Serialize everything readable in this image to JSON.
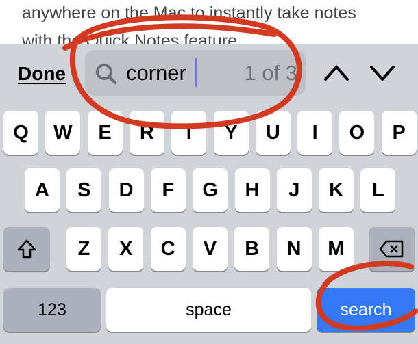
{
  "document": {
    "lines": [
      "anywhere on the Mac to instantly take notes",
      "with the Quick Notes feature"
    ]
  },
  "find_bar": {
    "done_label": "Done",
    "search_value": "corner",
    "match_count": "1 of 3",
    "search_icon": "magnifier-icon",
    "prev_icon": "chevron-up-icon",
    "next_icon": "chevron-down-icon"
  },
  "keyboard": {
    "row1": [
      "Q",
      "W",
      "E",
      "R",
      "T",
      "Y",
      "U",
      "I",
      "O",
      "P"
    ],
    "row2": [
      "A",
      "S",
      "D",
      "F",
      "G",
      "H",
      "J",
      "K",
      "L"
    ],
    "row3": [
      "Z",
      "X",
      "C",
      "V",
      "B",
      "N",
      "M"
    ],
    "shift_icon": "shift-icon",
    "delete_icon": "delete-icon",
    "numbers_label": "123",
    "space_label": "space",
    "search_label": "search"
  },
  "colors": {
    "accent": "#3478f6",
    "annotation": "#d33a22"
  }
}
